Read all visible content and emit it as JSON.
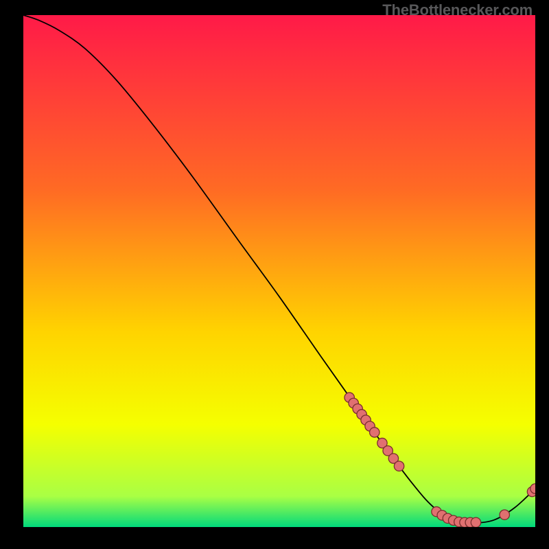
{
  "footer": {
    "credit": "TheBottlenecker.com"
  },
  "chart_data": {
    "type": "line",
    "title": "",
    "xlabel": "",
    "ylabel": "",
    "xlim": [
      0,
      100
    ],
    "ylim": [
      0,
      100
    ],
    "grid": false,
    "legend": false,
    "background_gradient": {
      "top": "#ff1a48",
      "mid_upper": "#ff6a24",
      "mid": "#ffd400",
      "mid_lower": "#f5ff00",
      "near_bottom": "#a9ff44",
      "bottom": "#00d97c"
    },
    "curve": [
      {
        "x": 0,
        "y": 100
      },
      {
        "x": 3,
        "y": 99
      },
      {
        "x": 7,
        "y": 97
      },
      {
        "x": 12,
        "y": 93.5
      },
      {
        "x": 18,
        "y": 87.5
      },
      {
        "x": 25,
        "y": 79
      },
      {
        "x": 33,
        "y": 68.5
      },
      {
        "x": 42,
        "y": 56
      },
      {
        "x": 50,
        "y": 45
      },
      {
        "x": 58,
        "y": 33.5
      },
      {
        "x": 64,
        "y": 25
      },
      {
        "x": 70,
        "y": 16.5
      },
      {
        "x": 76,
        "y": 8.5
      },
      {
        "x": 80,
        "y": 4
      },
      {
        "x": 84,
        "y": 1.3
      },
      {
        "x": 88,
        "y": 0.8
      },
      {
        "x": 92,
        "y": 1.4
      },
      {
        "x": 96,
        "y": 3.8
      },
      {
        "x": 100,
        "y": 7.5
      }
    ],
    "markers": [
      {
        "x": 63.7,
        "y": 25.3
      },
      {
        "x": 64.5,
        "y": 24.2
      },
      {
        "x": 65.3,
        "y": 23.1
      },
      {
        "x": 66.1,
        "y": 22.0
      },
      {
        "x": 66.9,
        "y": 20.9
      },
      {
        "x": 67.7,
        "y": 19.7
      },
      {
        "x": 68.6,
        "y": 18.5
      },
      {
        "x": 70.1,
        "y": 16.4
      },
      {
        "x": 71.2,
        "y": 14.9
      },
      {
        "x": 72.3,
        "y": 13.4
      },
      {
        "x": 73.4,
        "y": 11.9
      },
      {
        "x": 80.7,
        "y": 3.0
      },
      {
        "x": 81.8,
        "y": 2.3
      },
      {
        "x": 82.9,
        "y": 1.7
      },
      {
        "x": 84.0,
        "y": 1.3
      },
      {
        "x": 85.1,
        "y": 1.0
      },
      {
        "x": 86.2,
        "y": 0.9
      },
      {
        "x": 87.3,
        "y": 0.9
      },
      {
        "x": 88.4,
        "y": 0.9
      },
      {
        "x": 94.0,
        "y": 2.4
      },
      {
        "x": 99.4,
        "y": 6.9
      },
      {
        "x": 100.0,
        "y": 7.5
      }
    ],
    "marker_style": {
      "radius": 7.2,
      "fill": "#e07070",
      "stroke": "#7a2e2e",
      "stroke_width": 1.3
    },
    "line_style": {
      "stroke": "#000000",
      "width": 1.8
    }
  }
}
